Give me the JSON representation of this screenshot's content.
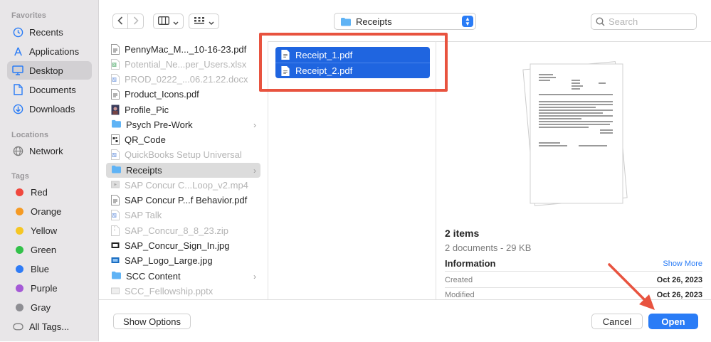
{
  "sidebar": {
    "favorites_header": "Favorites",
    "favorites": [
      {
        "label": "Recents",
        "icon": "clock-icon"
      },
      {
        "label": "Applications",
        "icon": "applications-icon"
      },
      {
        "label": "Desktop",
        "icon": "desktop-icon",
        "active": true
      },
      {
        "label": "Documents",
        "icon": "document-icon"
      },
      {
        "label": "Downloads",
        "icon": "download-icon"
      }
    ],
    "locations_header": "Locations",
    "locations": [
      {
        "label": "Network",
        "icon": "network-icon"
      }
    ],
    "tags_header": "Tags",
    "tags": [
      {
        "label": "Red",
        "color": "#f0483e"
      },
      {
        "label": "Orange",
        "color": "#f59a23"
      },
      {
        "label": "Yellow",
        "color": "#f5c623"
      },
      {
        "label": "Green",
        "color": "#33c14a"
      },
      {
        "label": "Blue",
        "color": "#2f7cf6"
      },
      {
        "label": "Purple",
        "color": "#a55ad6"
      },
      {
        "label": "Gray",
        "color": "#8e8e93"
      }
    ],
    "all_tags": "All Tags..."
  },
  "toolbar": {
    "location": "Receipts",
    "search_placeholder": "Search"
  },
  "files": [
    {
      "name": "PennyMac_M..._10-16-23.pdf",
      "type": "pdf",
      "dim": false
    },
    {
      "name": "Potential_Ne...per_Users.xlsx",
      "type": "xlsx",
      "dim": true
    },
    {
      "name": "PROD_0222_...06.21.22.docx",
      "type": "docx",
      "dim": true
    },
    {
      "name": "Product_Icons.pdf",
      "type": "pdf",
      "dim": false
    },
    {
      "name": "Profile_Pic",
      "type": "image",
      "dim": false
    },
    {
      "name": "Psych Pre-Work",
      "type": "folder",
      "dim": false
    },
    {
      "name": "QR_Code",
      "type": "qr",
      "dim": false
    },
    {
      "name": "QuickBooks Setup Universal",
      "type": "docx",
      "dim": true
    },
    {
      "name": "Receipts",
      "type": "folder",
      "dim": false,
      "selected": true
    },
    {
      "name": "SAP Concur C...Loop_v2.mp4",
      "type": "video",
      "dim": true
    },
    {
      "name": "SAP Concur P...f Behavior.pdf",
      "type": "pdf",
      "dim": false
    },
    {
      "name": "SAP Talk",
      "type": "docx",
      "dim": true
    },
    {
      "name": "SAP_Concur_8_8_23.zip",
      "type": "zip",
      "dim": true
    },
    {
      "name": "SAP_Concur_Sign_In.jpg",
      "type": "jpg",
      "dim": false
    },
    {
      "name": "SAP_Logo_Large.jpg",
      "type": "jpg",
      "dim": false
    },
    {
      "name": "SCC Content",
      "type": "folder",
      "dim": false
    },
    {
      "name": "SCC_Fellowship.pptx",
      "type": "pptx",
      "dim": true
    }
  ],
  "selected_files": [
    "Receipt_1.pdf",
    "Receipt_2.pdf"
  ],
  "preview": {
    "count": "2 items",
    "summary": "2 documents - 29 KB",
    "info_header": "Information",
    "show_more": "Show More",
    "created_label": "Created",
    "created_value": "Oct 26, 2023",
    "modified_label": "Modified",
    "modified_value": "Oct 26, 2023"
  },
  "footer": {
    "show_options": "Show Options",
    "cancel": "Cancel",
    "open": "Open"
  }
}
